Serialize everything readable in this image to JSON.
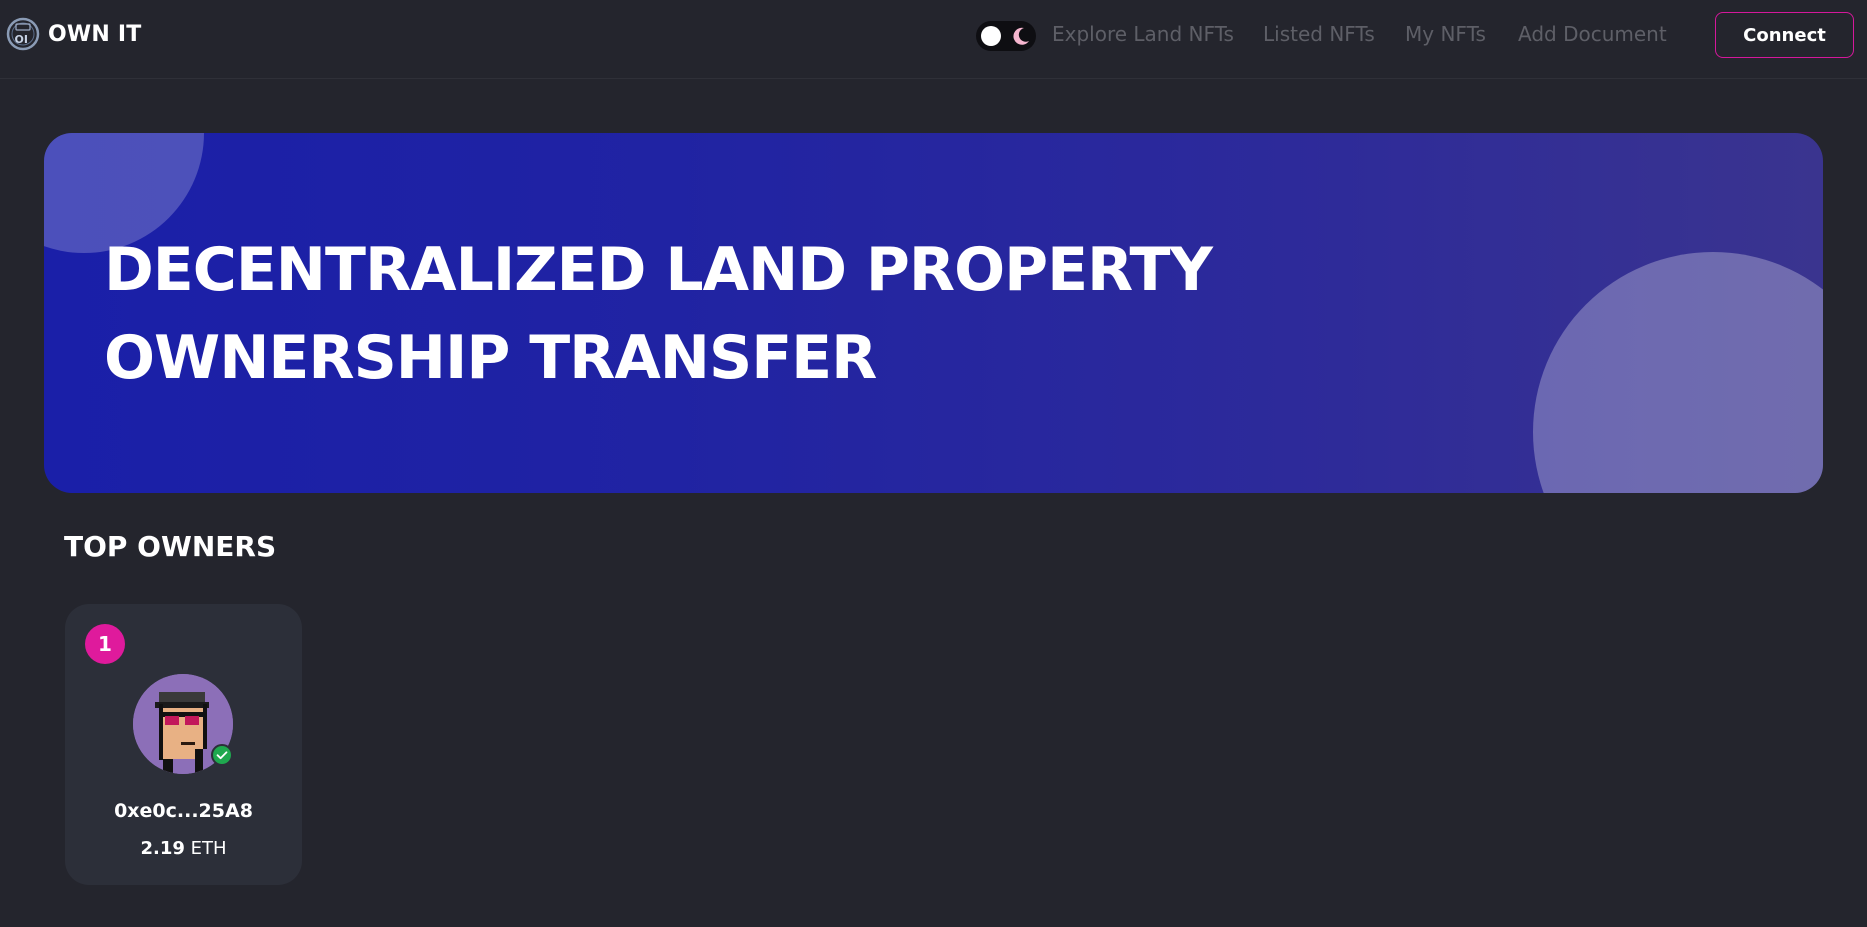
{
  "header": {
    "brand": "OWN IT",
    "logo_icon": "own-it-logo-icon",
    "theme_icon": "moon-icon",
    "nav": [
      {
        "label": "Explore Land NFTs"
      },
      {
        "label": "Listed NFTs"
      },
      {
        "label": "My NFTs"
      },
      {
        "label": "Add Document"
      }
    ],
    "connect_label": "Connect"
  },
  "hero": {
    "title": "DECENTRALIZED LAND PROPERTY OWNERSHIP TRANSFER"
  },
  "top_owners": {
    "title": "TOP OWNERS",
    "owners": [
      {
        "rank": "1",
        "address": "0xe0c...25A8",
        "amount": "2.19",
        "unit": "ETH",
        "avatar_icon": "pixel-punk-avatar",
        "verified_icon": "verified-check-icon"
      }
    ]
  },
  "colors": {
    "background": "#24252d",
    "accent": "#df1a9c",
    "hero_start": "#1a1fa8",
    "hero_end": "#3a348f",
    "card": "#2c2f39",
    "nav_text": "#5e5f67",
    "verified": "#1fa84f"
  }
}
